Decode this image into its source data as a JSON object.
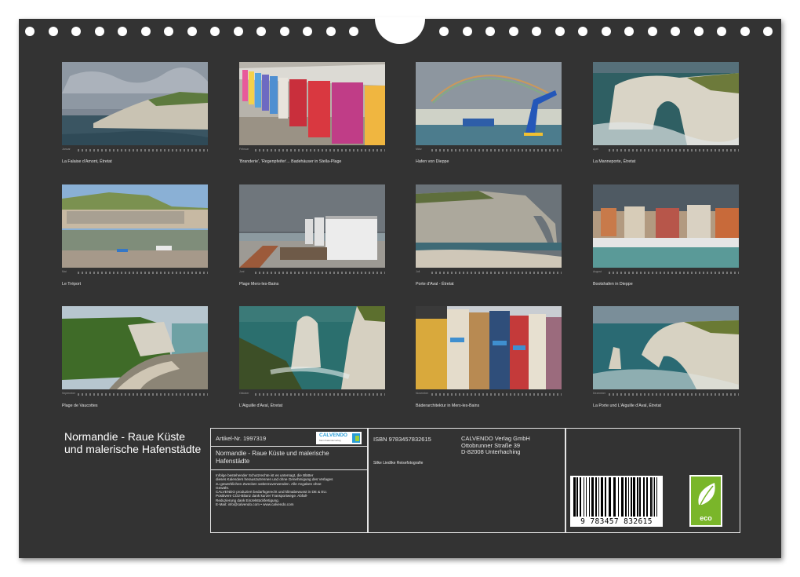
{
  "calendar_title": "Normandie - Raue Küste und malerische Hafenstädte",
  "months": [
    {
      "abbr": "Januar",
      "caption": "La Falaise d'Amont, Étretat"
    },
    {
      "abbr": "Februar",
      "caption": "'Branderie', 'Regenpfeifer'... Badehäuser in Stella-Plage"
    },
    {
      "abbr": "März",
      "caption": "Hafen von Dieppe"
    },
    {
      "abbr": "April",
      "caption": "La Manneporte, Étretat"
    },
    {
      "abbr": "Mai",
      "caption": "Le Tréport"
    },
    {
      "abbr": "Juni",
      "caption": "Plage Mers-les-Bains"
    },
    {
      "abbr": "Juli",
      "caption": "Porte d'Aval - Étretat"
    },
    {
      "abbr": "August",
      "caption": "Bootshafen in Dieppe"
    },
    {
      "abbr": "September",
      "caption": "Plage de Vaucottes"
    },
    {
      "abbr": "Oktober",
      "caption": "L'Aiguille d'Aval, Étretat"
    },
    {
      "abbr": "November",
      "caption": "Bäderarchitektur in Mers-les-Bains"
    },
    {
      "abbr": "Dezember",
      "caption": "La Porte und L'Aiguille d'Aval, Étretat"
    }
  ],
  "info": {
    "article_number": "Artikel-Nr. 1997319",
    "logo_name": "CALVENDO",
    "logo_sub": "Mein Kalenderverlag",
    "subtitle": "Normandie - Raue Küste und malerische Hafenstädte",
    "legal": [
      "Infolge bestehender Schutzrechte ist es untersagt, die Blätter",
      "dieses Kalenders herauszutrennen und ohne Genehmigung des Verlages",
      "zu gewerblichen Zwecken weiterzuverwenden. Alle Angaben ohne",
      "Gewähr.",
      "CALVENDO produziert bedarfsgerecht und klimabewusst in DE & EU.",
      "Positivere CO2-Bilanz dank kurzer Transportwege. Abfall-",
      "Reduzierung dank Einzelstückfertigung.",
      "E-Mail: info@calvendo.com • www.calvendo.com"
    ],
    "isbn": "ISBN 9783457832615",
    "photographer": "Silke Liedtke Reisefotografie",
    "publisher": [
      "CALVENDO Verlag GmbH",
      "Ottobrunner Straße 39",
      "D-82008 Unterhaching"
    ],
    "barcode_number": "9 783457 832615",
    "eco_label": "eco"
  },
  "colors": {
    "background": "#333333",
    "text": "#e6e6e6",
    "eco_green": "#7ab62a",
    "calvendo_blue": "#2a9ed8"
  }
}
